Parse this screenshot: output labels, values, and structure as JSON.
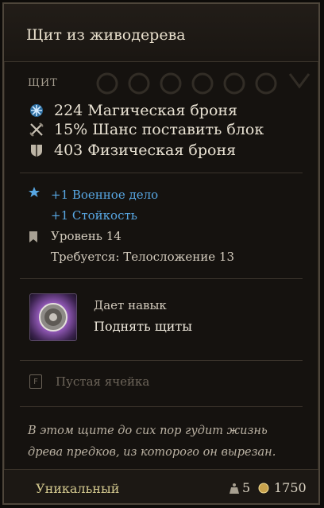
{
  "item": {
    "title": "Щит из живодерева",
    "slot_type": "ЩИТ",
    "stats": [
      {
        "value": "224",
        "label": "Магическая броня",
        "icon": "magic-armor-icon"
      },
      {
        "value": "15%",
        "label": "Шанс поставить блок",
        "icon": "block-icon"
      },
      {
        "value": "403",
        "label": "Физическая броня",
        "icon": "physical-armor-icon"
      }
    ],
    "bonuses": [
      "+1 Военное дело",
      "+1 Стойкость"
    ],
    "level_label": "Уровень 14",
    "requirement": "Требуется: Телосложение 13",
    "skill": {
      "caption": "Дает навык",
      "name": "Поднять щиты",
      "icon": "raise-shields-skill-icon"
    },
    "empty_slot": {
      "label": "Пустая ячейка",
      "icon_letter": "F"
    },
    "flavor": "В этом щите до сих пор гудит жизнь древа предков, из которого он вырезан.",
    "rarity": "Уникальный",
    "weight": "5",
    "value": "1750",
    "colors": {
      "bonus": "#58a7e3",
      "rarity": "#d3c88e",
      "background": "#15120f"
    }
  }
}
